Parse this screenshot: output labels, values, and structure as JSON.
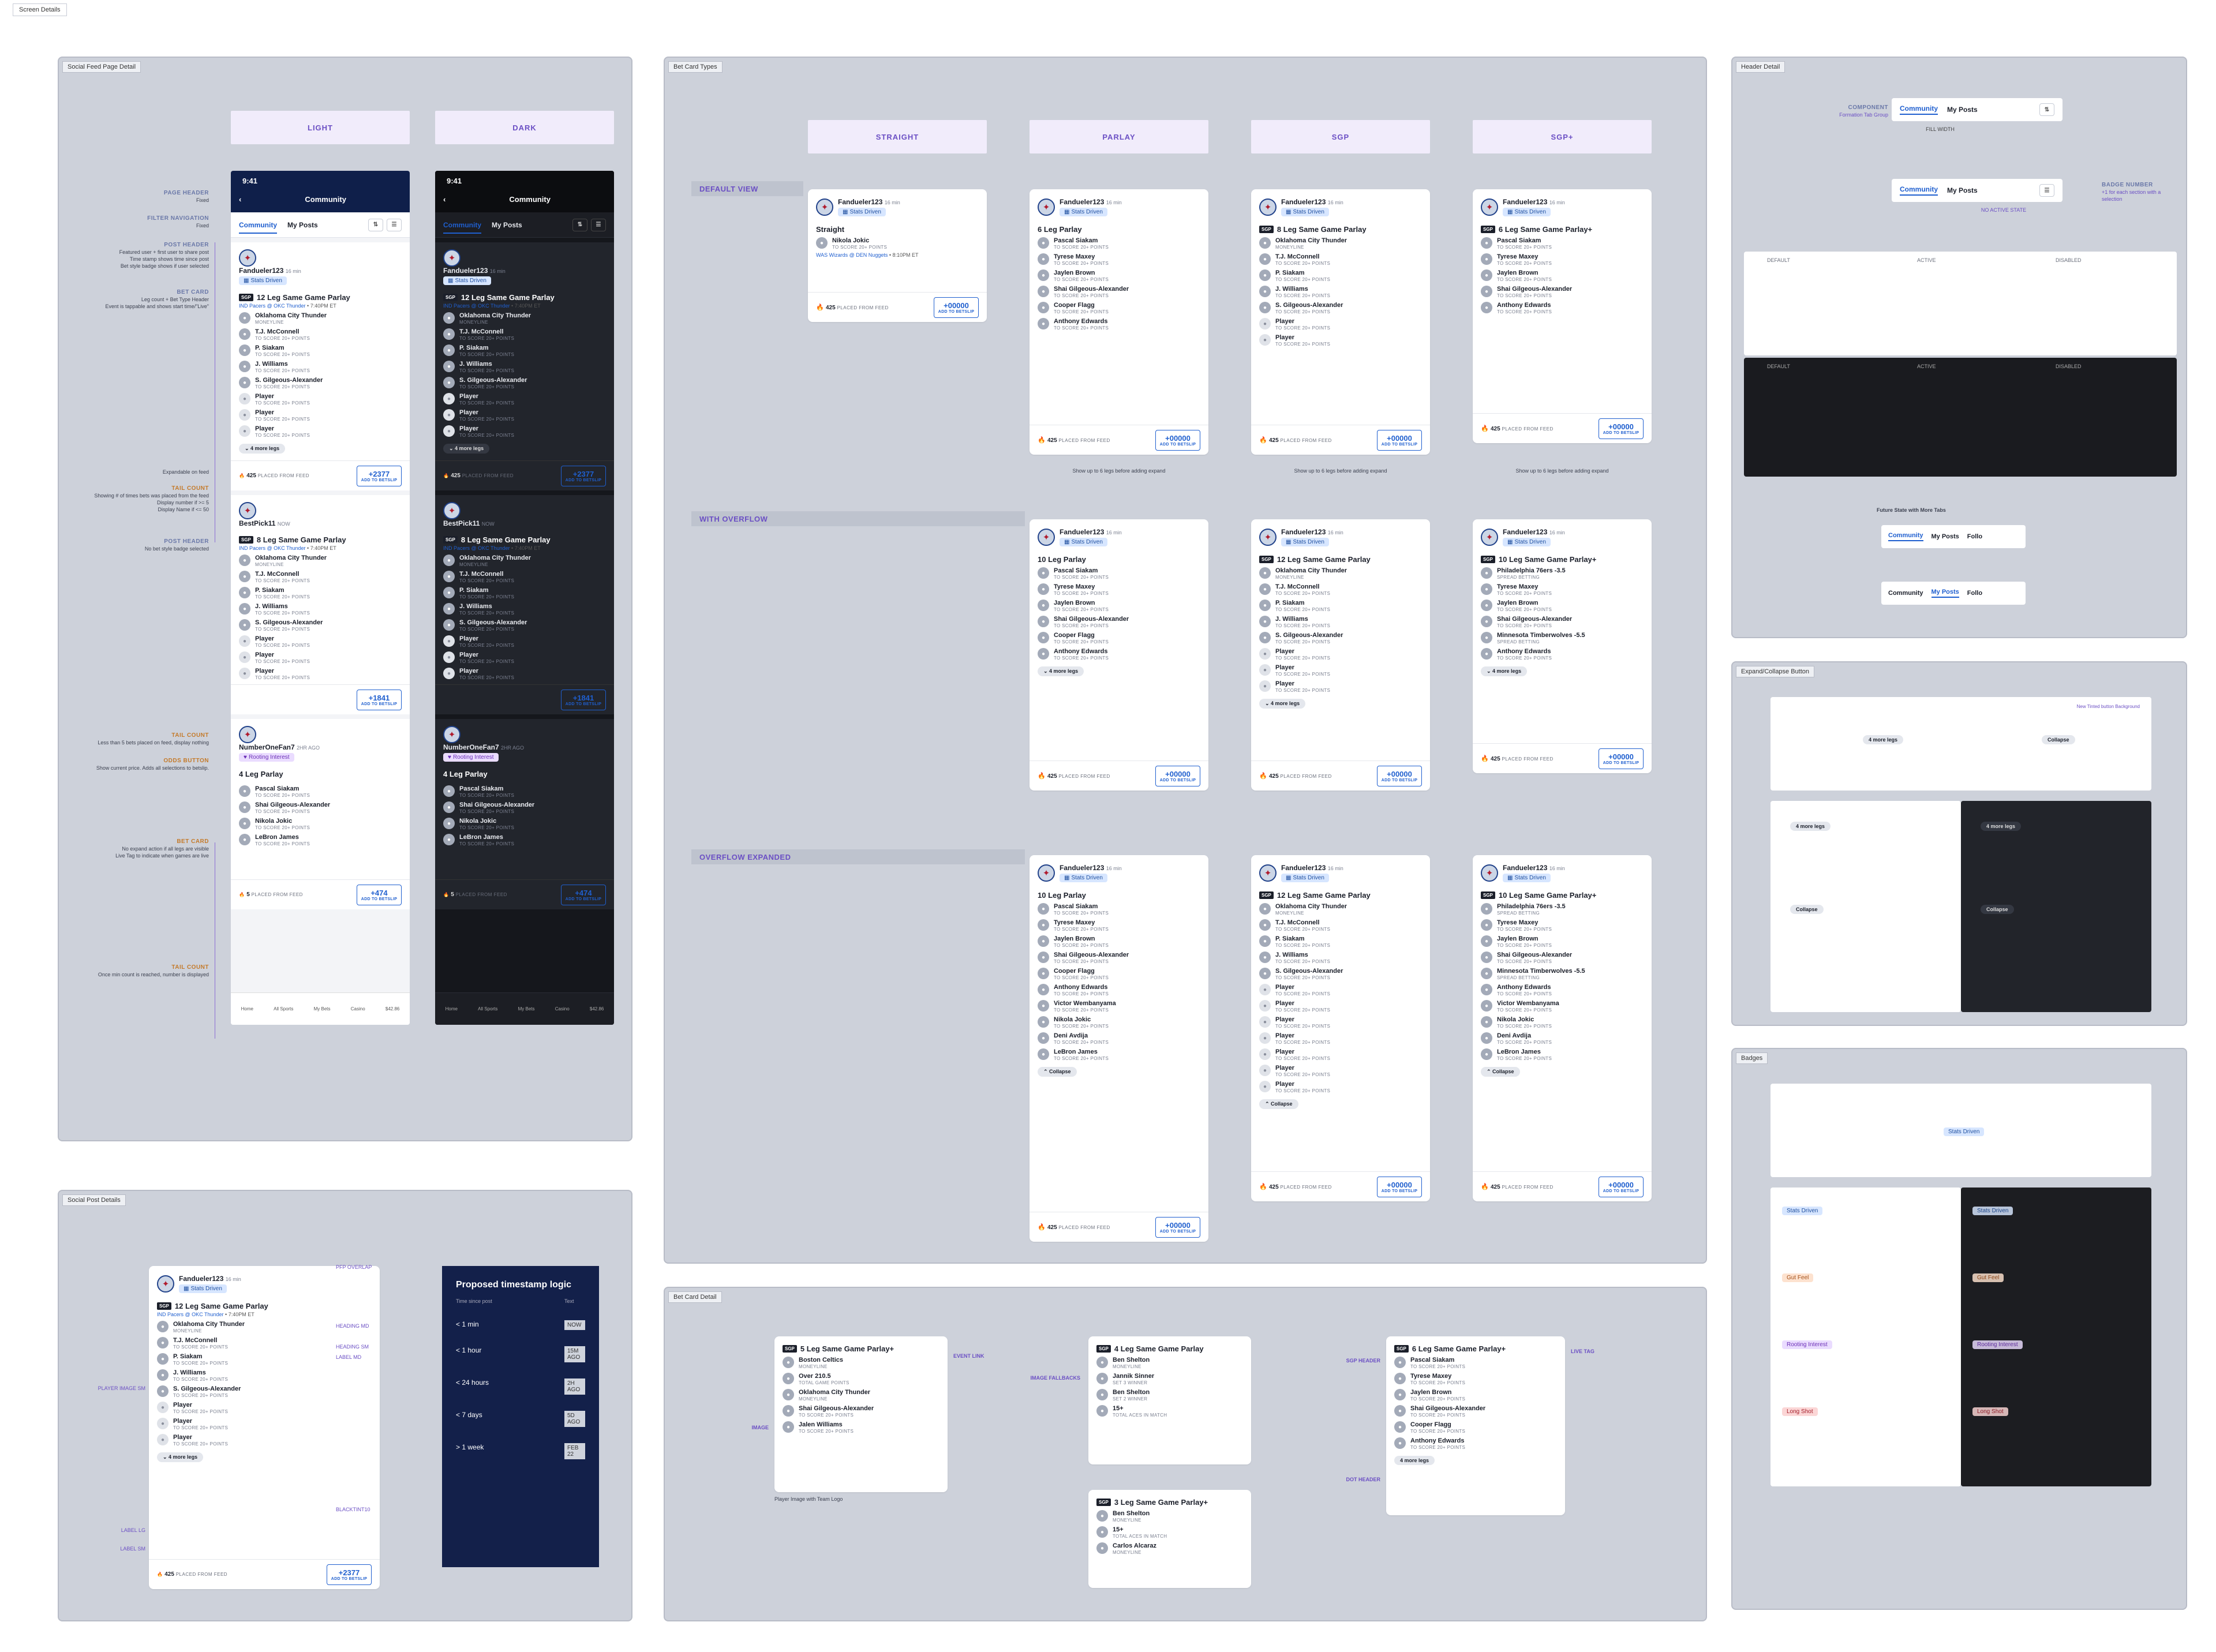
{
  "screen_label": "Screen Details",
  "panels": {
    "social_feed": "Social Feed Page Detail",
    "bet_card_types": "Bet Card Types",
    "header_detail": "Header Detail",
    "social_post": "Social Post Details",
    "bet_card_detail": "Bet Card Detail",
    "expand_collapse": "Expand/Collapse Button",
    "badges": "Badges"
  },
  "themes": {
    "light": "LIGHT",
    "dark": "DARK"
  },
  "phone": {
    "time": "9:41",
    "title": "Community",
    "tab_community": "Community",
    "tab_myposts": "My Posts",
    "nav": [
      "Home",
      "All Sports",
      "My Bets",
      "Casino",
      "$42.86"
    ],
    "account": "Account"
  },
  "feed_annotations": {
    "page_header": "PAGE HEADER",
    "page_header_sub": "Fixed",
    "filter_nav": "FILTER NAVIGATION",
    "filter_nav_sub": "Fixed",
    "post_header": "POST HEADER",
    "post_header_sub": "Featured user + first user to share post\nTime stamp shows time since post\nBet style badge shows if user selected",
    "bet_card": "BET CARD",
    "bet_card_sub": "Leg count + Bet Type Header\nEvent is tappable and shows start time/\"Live\"",
    "expandable": "Expandable on feed",
    "tail_count": "TAIL COUNT",
    "tail_count_sub": "Showing # of times bets was placed from the feed\nDisplay number if >= 5\nDisplay Name if <= 50",
    "post_header2": "POST HEADER",
    "post_header2_sub": "No bet style badge selected",
    "tail_count2": "TAIL COUNT",
    "tail_count2_sub": "Less than 5 bets placed on feed, display nothing",
    "odds_button": "ODDS BUTTON",
    "odds_button_sub": "Show current price. Adds all selections to betslip.",
    "bet_card2": "BET CARD",
    "bet_card2_sub": "No expand action if all legs are visible\nLive Tag to indicate when games are live",
    "tail_count3": "TAIL COUNT",
    "tail_count3_sub": "Once min count is reached, number is displayed"
  },
  "posts": [
    {
      "user": "Fandueler123",
      "time": "16 min",
      "badge": "Stats Driven",
      "title": "12 Leg Same Game Parlay",
      "event": "IND Pacers @ OKC Thunder",
      "etime": "7:40PM ET",
      "legs": [
        [
          "Oklahoma City Thunder",
          "MONEYLINE"
        ],
        [
          "T.J. McConnell",
          "TO SCORE 20+ POINTS"
        ],
        [
          "P. Siakam",
          "TO SCORE 20+ POINTS"
        ],
        [
          "J. Williams",
          "TO SCORE 20+ POINTS"
        ],
        [
          "S. Gilgeous-Alexander",
          "TO SCORE 20+ POINTS"
        ],
        [
          "Player",
          "TO SCORE 20+ POINTS"
        ],
        [
          "Player",
          "TO SCORE 20+ POINTS"
        ],
        [
          "Player",
          "TO SCORE 20+ POINTS"
        ]
      ],
      "more": "4 more legs",
      "placed": "425",
      "placed_label": "PLACED FROM FEED",
      "odds": "+2377",
      "odds_label": "ADD TO BETSLIP"
    },
    {
      "user": "BestPick11",
      "time": "NOW",
      "badge": "",
      "title": "8 Leg Same Game Parlay",
      "event": "IND Pacers @ OKC Thunder",
      "etime": "7:40PM ET",
      "legs": [
        [
          "Oklahoma City Thunder",
          "MONEYLINE"
        ],
        [
          "T.J. McConnell",
          "TO SCORE 20+ POINTS"
        ],
        [
          "P. Siakam",
          "TO SCORE 20+ POINTS"
        ],
        [
          "J. Williams",
          "TO SCORE 20+ POINTS"
        ],
        [
          "S. Gilgeous-Alexander",
          "TO SCORE 20+ POINTS"
        ],
        [
          "Player",
          "TO SCORE 20+ POINTS"
        ],
        [
          "Player",
          "TO SCORE 20+ POINTS"
        ],
        [
          "Player",
          "TO SCORE 20+ POINTS"
        ]
      ],
      "more": "",
      "placed": "",
      "placed_label": "",
      "odds": "+1841",
      "odds_label": "ADD TO BETSLIP"
    },
    {
      "user": "NumberOneFan7",
      "time": "2HR AGO",
      "badge": "Rooting Interest",
      "title": "4 Leg Parlay",
      "event": "",
      "etime": "",
      "legs": [
        [
          "Pascal Siakam",
          "TO SCORE 20+ POINTS"
        ],
        [
          "Shai Gilgeous-Alexander",
          "TO SCORE 20+ POINTS"
        ],
        [
          "Nikola Jokic",
          "TO SCORE 20+ POINTS"
        ],
        [
          "LeBron James",
          "TO SCORE 20+ POINTS"
        ]
      ],
      "more": "",
      "placed": "5",
      "placed_label": "PLACED FROM FEED",
      "odds": "+474",
      "odds_label": "ADD TO BETSLIP"
    }
  ],
  "bet_types": {
    "straight": "STRAIGHT",
    "parlay": "PARLAY",
    "sgp": "SGP",
    "sgpplus": "SGP+",
    "default_view": "DEFAULT VIEW",
    "with_overflow": "WITH OVERFLOW",
    "overflow_expanded": "OVERFLOW EXPANDED",
    "note": "Show up to 6 legs before adding expand"
  },
  "cards": {
    "straight": {
      "title": "Straight",
      "legs": [
        [
          "Nikola Jokic",
          "TO SCORE 20+ POINTS"
        ]
      ],
      "event": "WAS Wizards @ DEN Nuggets",
      "etime": "8:10PM ET"
    },
    "parlay6": {
      "title": "6 Leg Parlay",
      "legs": [
        [
          "Pascal Siakam",
          "TO SCORE 20+ POINTS"
        ],
        [
          "Tyrese Maxey",
          "TO SCORE 20+ POINTS"
        ],
        [
          "Jaylen Brown",
          "TO SCORE 20+ POINTS"
        ],
        [
          "Shai Gilgeous-Alexander",
          "TO SCORE 20+ POINTS"
        ],
        [
          "Cooper Flagg",
          "TO SCORE 20+ POINTS"
        ],
        [
          "Anthony Edwards",
          "TO SCORE 20+ POINTS"
        ]
      ]
    },
    "sgp8": {
      "title": "8 Leg Same Game Parlay",
      "legs": [
        [
          "Oklahoma City Thunder",
          "MONEYLINE"
        ],
        [
          "T.J. McConnell",
          "TO SCORE 20+ POINTS"
        ],
        [
          "P. Siakam",
          "TO SCORE 20+ POINTS"
        ],
        [
          "J. Williams",
          "TO SCORE 20+ POINTS"
        ],
        [
          "S. Gilgeous-Alexander",
          "TO SCORE 20+ POINTS"
        ],
        [
          "Player",
          "TO SCORE 20+ POINTS"
        ],
        [
          "Player",
          "TO SCORE 20+ POINTS"
        ]
      ]
    },
    "sgpp6": {
      "title": "6 Leg Same Game Parlay+",
      "legs": [
        [
          "Pascal Siakam",
          "TO SCORE 20+ POINTS"
        ],
        [
          "Tyrese Maxey",
          "TO SCORE 20+ POINTS"
        ],
        [
          "Jaylen Brown",
          "TO SCORE 20+ POINTS"
        ],
        [
          "Shai Gilgeous-Alexander",
          "TO SCORE 20+ POINTS"
        ],
        [
          "Anthony Edwards",
          "TO SCORE 20+ POINTS"
        ]
      ]
    },
    "parlay10": {
      "title": "10 Leg Parlay",
      "legs": [
        [
          "Pascal Siakam",
          "TO SCORE 20+ POINTS"
        ],
        [
          "Tyrese Maxey",
          "TO SCORE 20+ POINTS"
        ],
        [
          "Jaylen Brown",
          "TO SCORE 20+ POINTS"
        ],
        [
          "Shai Gilgeous-Alexander",
          "TO SCORE 20+ POINTS"
        ],
        [
          "Cooper Flagg",
          "TO SCORE 20+ POINTS"
        ],
        [
          "Anthony Edwards",
          "TO SCORE 20+ POINTS"
        ]
      ]
    },
    "sgp12": {
      "title": "12 Leg Same Game Parlay",
      "legs": [
        [
          "Oklahoma City Thunder",
          "MONEYLINE"
        ],
        [
          "T.J. McConnell",
          "TO SCORE 20+ POINTS"
        ],
        [
          "P. Siakam",
          "TO SCORE 20+ POINTS"
        ],
        [
          "J. Williams",
          "TO SCORE 20+ POINTS"
        ],
        [
          "S. Gilgeous-Alexander",
          "TO SCORE 20+ POINTS"
        ],
        [
          "Player",
          "TO SCORE 20+ POINTS"
        ],
        [
          "Player",
          "TO SCORE 20+ POINTS"
        ],
        [
          "Player",
          "TO SCORE 20+ POINTS"
        ]
      ]
    },
    "sgpp10": {
      "title": "10 Leg Same Game Parlay+",
      "legs": [
        [
          "Philadelphia 76ers -3.5",
          "SPREAD BETTING"
        ],
        [
          "Tyrese Maxey",
          "TO SCORE 20+ POINTS"
        ],
        [
          "Jaylen Brown",
          "TO SCORE 20+ POINTS"
        ],
        [
          "Shai Gilgeous-Alexander",
          "TO SCORE 20+ POINTS"
        ],
        [
          "Minnesota Timberwolves -5.5",
          "SPREAD BETTING"
        ],
        [
          "Anthony Edwards",
          "TO SCORE 20+ POINTS"
        ]
      ]
    },
    "parlay10x": {
      "title": "10 Leg Parlay",
      "legs": [
        [
          "Pascal Siakam",
          "TO SCORE 20+ POINTS"
        ],
        [
          "Tyrese Maxey",
          "TO SCORE 20+ POINTS"
        ],
        [
          "Jaylen Brown",
          "TO SCORE 20+ POINTS"
        ],
        [
          "Shai Gilgeous-Alexander",
          "TO SCORE 20+ POINTS"
        ],
        [
          "Cooper Flagg",
          "TO SCORE 20+ POINTS"
        ],
        [
          "Anthony Edwards",
          "TO SCORE 20+ POINTS"
        ],
        [
          "Victor Wembanyama",
          "TO SCORE 20+ POINTS"
        ],
        [
          "Nikola Jokic",
          "TO SCORE 20+ POINTS"
        ],
        [
          "Deni Avdija",
          "TO SCORE 20+ POINTS"
        ],
        [
          "LeBron James",
          "TO SCORE 20+ POINTS"
        ]
      ]
    },
    "sgp12x": {
      "title": "12 Leg Same Game Parlay",
      "legs": [
        [
          "Oklahoma City Thunder",
          "MONEYLINE"
        ],
        [
          "T.J. McConnell",
          "TO SCORE 20+ POINTS"
        ],
        [
          "P. Siakam",
          "TO SCORE 20+ POINTS"
        ],
        [
          "J. Williams",
          "TO SCORE 20+ POINTS"
        ],
        [
          "S. Gilgeous-Alexander",
          "TO SCORE 20+ POINTS"
        ],
        [
          "Player",
          "TO SCORE 20+ POINTS"
        ],
        [
          "Player",
          "TO SCORE 20+ POINTS"
        ],
        [
          "Player",
          "TO SCORE 20+ POINTS"
        ],
        [
          "Player",
          "TO SCORE 20+ POINTS"
        ],
        [
          "Player",
          "TO SCORE 20+ POINTS"
        ],
        [
          "Player",
          "TO SCORE 20+ POINTS"
        ],
        [
          "Player",
          "TO SCORE 20+ POINTS"
        ]
      ]
    },
    "sgpp10x": {
      "title": "10 Leg Same Game Parlay+",
      "legs": [
        [
          "Philadelphia 76ers -3.5",
          "SPREAD BETTING"
        ],
        [
          "Tyrese Maxey",
          "TO SCORE 20+ POINTS"
        ],
        [
          "Jaylen Brown",
          "TO SCORE 20+ POINTS"
        ],
        [
          "Shai Gilgeous-Alexander",
          "TO SCORE 20+ POINTS"
        ],
        [
          "Minnesota Timberwolves -5.5",
          "SPREAD BETTING"
        ],
        [
          "Anthony Edwards",
          "TO SCORE 20+ POINTS"
        ],
        [
          "Victor Wembanyama",
          "TO SCORE 20+ POINTS"
        ],
        [
          "Nikola Jokic",
          "TO SCORE 20+ POINTS"
        ],
        [
          "Deni Avdija",
          "TO SCORE 20+ POINTS"
        ],
        [
          "LeBron James",
          "TO SCORE 20+ POINTS"
        ]
      ]
    },
    "footer": {
      "placed": "425",
      "placed_label": "PLACED FROM FEED",
      "odds": "+00000",
      "odds_label": "ADD TO BETSLIP",
      "more": "4 more legs",
      "collapse": "Collapse"
    }
  },
  "card_user": {
    "user": "Fandueler123",
    "time": "16 min",
    "badge": "Stats Driven"
  },
  "header_detail": {
    "component": "COMPONENT",
    "component_sub": "Formation Tab Group",
    "fill": "FILL WIDTH",
    "badge_number": "BADGE NUMBER",
    "badge_sub": "+1 for each section with a selection",
    "no_active": "NO ACTIVE STATE",
    "default": "DEFAULT",
    "active": "ACTIVE",
    "disabled": "DISABLED",
    "future": "Future State with More Tabs",
    "follo": "Follo"
  },
  "expand": {
    "more": "4 more legs",
    "collapse": "Collapse",
    "note": "New Tinted button Background"
  },
  "badge_list": [
    "Stats Driven",
    "Gut Feel",
    "Rooting Interest",
    "Long Shot"
  ],
  "post_details": {
    "timestamp_title": "Proposed timestamp logic",
    "col1": "Time since post",
    "col2": "Text",
    "rows": [
      [
        "< 1 min",
        "NOW"
      ],
      [
        "< 1 hour",
        "15M AGO"
      ],
      [
        "< 24 hours",
        "2H AGO"
      ],
      [
        "< 7 days",
        "5D AGO"
      ],
      [
        "> 1 week",
        "FEB 22"
      ]
    ],
    "labels": {
      "pfp": "PFP OVERLAP",
      "heading": "HEADING MD",
      "heading_sm": "HEADING SM",
      "label_md": "LABEL MD",
      "player_image": "PLAYER IMAGE SM",
      "label_lg": "LABEL LG",
      "label_sm": "LABEL SM",
      "blacktint": "BLACKTINT10"
    }
  },
  "bet_card_detail": {
    "title1": "5 Leg Same Game Parlay+",
    "title2": "4 Leg Same Game Parlay",
    "title3": "6 Leg Same Game Parlay+",
    "title4": "3 Leg Same Game Parlay+",
    "event_link": "EVENT LINK",
    "image": "IMAGE",
    "image_fallbacks": "IMAGE FALLBACKS",
    "sgp_header": "SGP HEADER",
    "live_tag": "LIVE TAG",
    "dot_header": "DOT HEADER",
    "player_team": "Player Image with Team Logo",
    "legs1": [
      [
        "Boston Celtics",
        "MONEYLINE"
      ],
      [
        "Over 210.5",
        "TOTAL GAME POINTS"
      ],
      [
        "Oklahoma City Thunder",
        "MONEYLINE"
      ],
      [
        "Shai Gilgeous-Alexander",
        "TO SCORE 20+ POINTS"
      ],
      [
        "Jalen Williams",
        "TO SCORE 20+ POINTS"
      ]
    ],
    "legs2": [
      [
        "Ben Shelton",
        "MONEYLINE"
      ],
      [
        "Jannik Sinner",
        "SET 3 WINNER"
      ],
      [
        "Ben Shelton",
        "SET 2 WINNER"
      ],
      [
        "15+",
        "TOTAL ACES IN MATCH"
      ]
    ],
    "legs3": [
      [
        "Pascal Siakam",
        "TO SCORE 20+ POINTS"
      ],
      [
        "Tyrese Maxey",
        "TO SCORE 20+ POINTS"
      ],
      [
        "Jaylen Brown",
        "TO SCORE 20+ POINTS"
      ],
      [
        "Shai Gilgeous-Alexander",
        "TO SCORE 20+ POINTS"
      ],
      [
        "Cooper Flagg",
        "TO SCORE 20+ POINTS"
      ],
      [
        "Anthony Edwards",
        "TO SCORE 20+ POINTS"
      ]
    ],
    "legs4": [
      [
        "Ben Shelton",
        "MONEYLINE"
      ],
      [
        "15+",
        "TOTAL ACES IN MATCH"
      ],
      [
        "Carlos Alcaraz",
        "MONEYLINE"
      ]
    ]
  }
}
